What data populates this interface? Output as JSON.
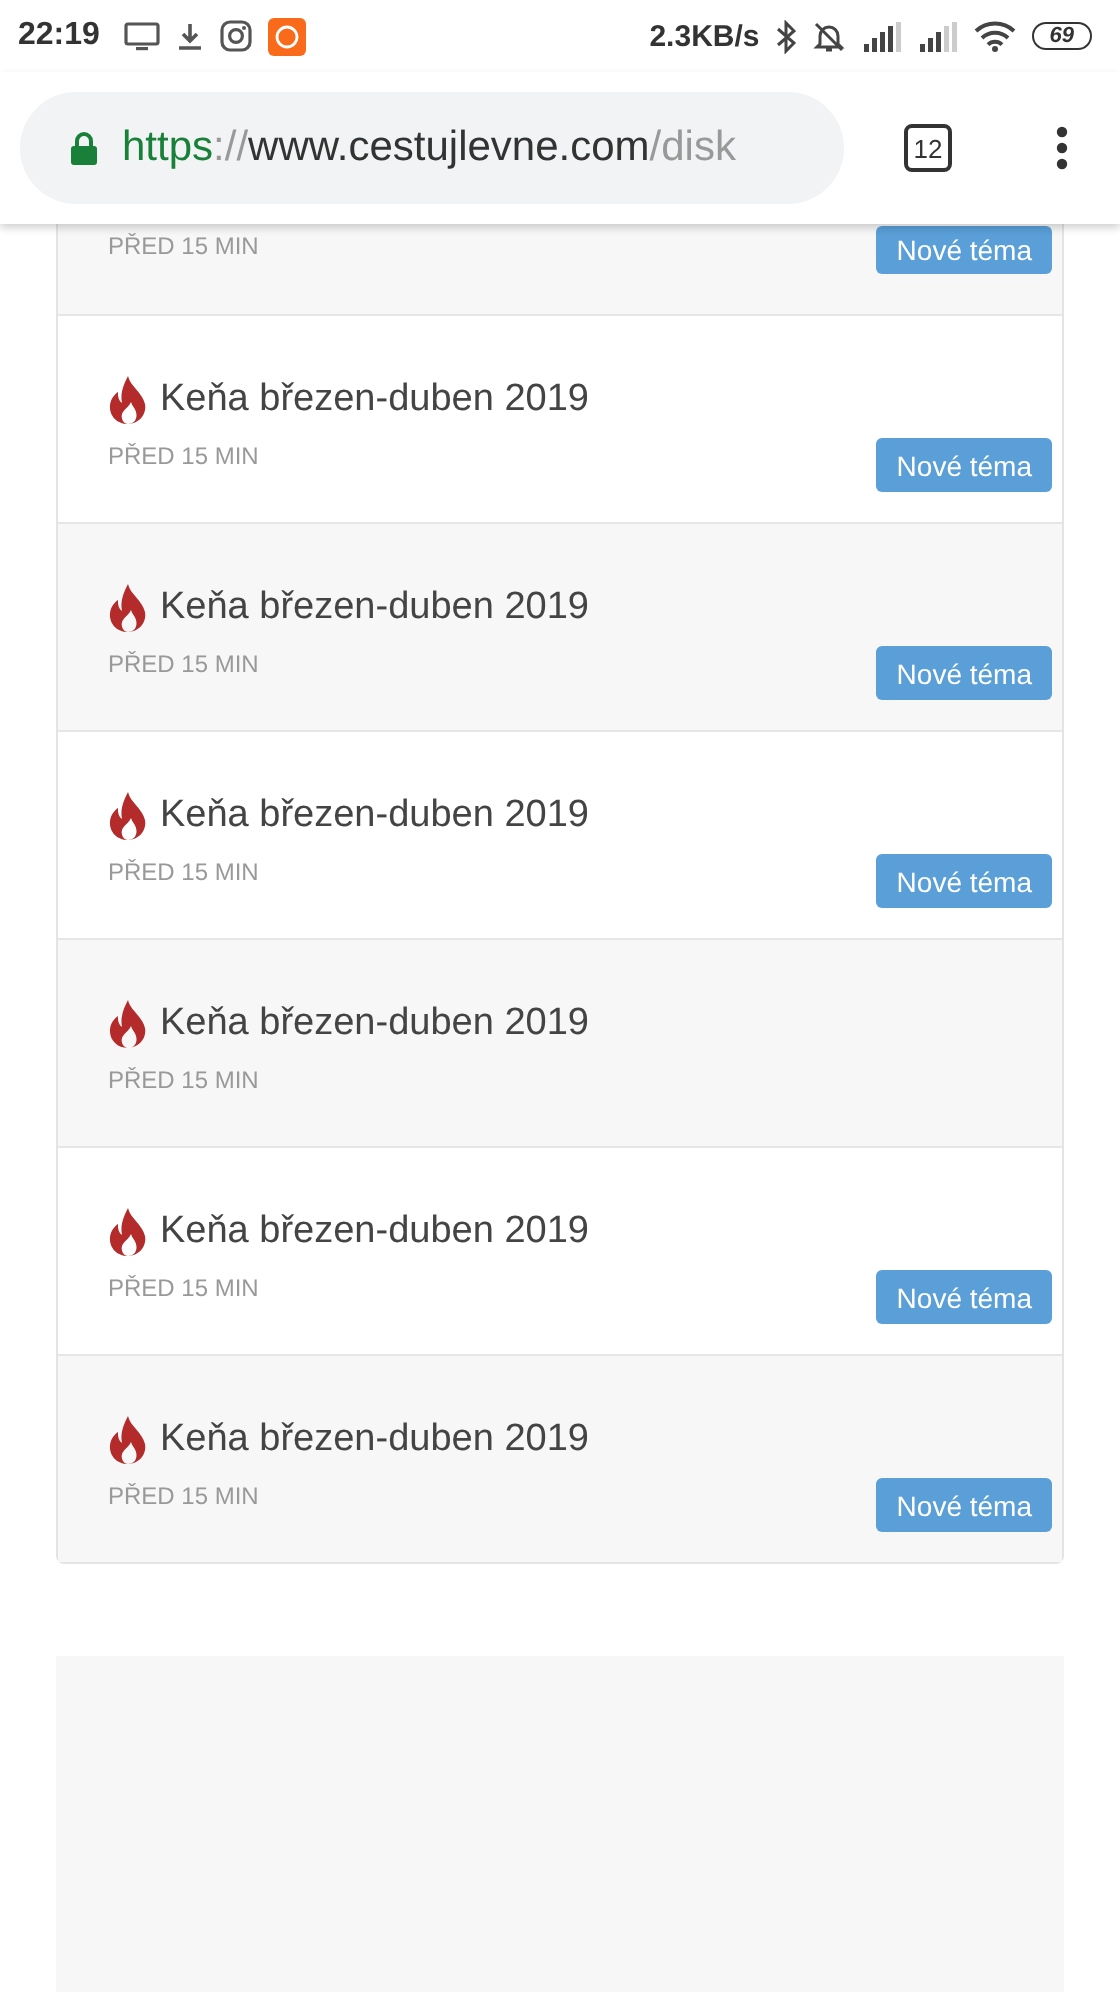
{
  "status_bar": {
    "time": "22:19",
    "speed": "2.3KB/s",
    "battery": "69"
  },
  "browser": {
    "url_scheme": "https",
    "url_sep": "://",
    "url_host": "www.cestujlevne.com",
    "url_path": "/disk",
    "tab_count": "12"
  },
  "topics": [
    {
      "kind": "partial",
      "time": "PŘED 15 MIN",
      "button": "Nové téma"
    },
    {
      "kind": "full",
      "hot": true,
      "title": "Keňa březen-duben 2019",
      "time": "PŘED 15 MIN",
      "button": "Nové téma"
    },
    {
      "kind": "full",
      "hot": true,
      "title": "Keňa březen-duben 2019",
      "time": "PŘED 15 MIN",
      "button": "Nové téma"
    },
    {
      "kind": "full",
      "hot": true,
      "title": "Keňa březen-duben 2019",
      "time": "PŘED 15 MIN",
      "button": "Nové téma"
    },
    {
      "kind": "full",
      "hot": true,
      "title": "Keňa březen-duben 2019",
      "time": "PŘED 15 MIN"
    },
    {
      "kind": "full",
      "hot": true,
      "title": "Keňa březen-duben 2019",
      "time": "PŘED 15 MIN",
      "button": "Nové téma"
    },
    {
      "kind": "full",
      "hot": true,
      "title": "Keňa březen-duben 2019",
      "time": "PŘED 15 MIN",
      "button": "Nové téma"
    }
  ]
}
